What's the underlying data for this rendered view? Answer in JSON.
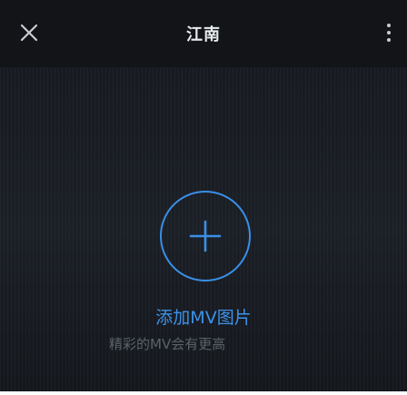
{
  "header": {
    "title": "江南",
    "close_icon": "close-icon",
    "more_icon": "more-vertical-icon"
  },
  "main": {
    "add_icon": "plus-icon",
    "add_label": "添加MV图片",
    "hint": "精彩的MV会有更高"
  },
  "colors": {
    "accent": "#3a8fe6",
    "background": "#15181d",
    "header_background": "#121418"
  }
}
